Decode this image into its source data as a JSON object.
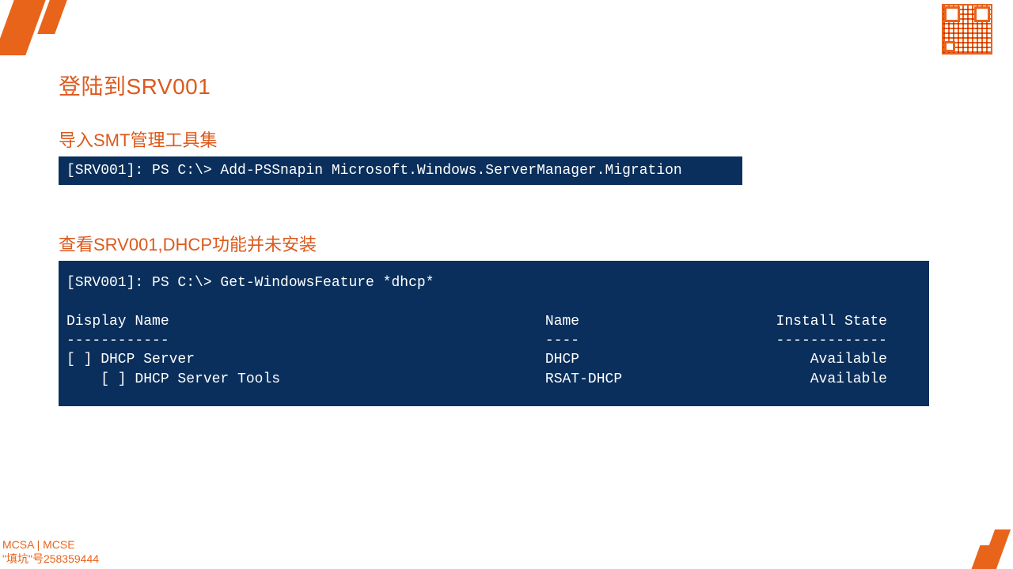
{
  "headings": {
    "main": "登陆到SRV001",
    "sub1": "导入SMT管理工具集",
    "sub2": "查看SRV001,DHCP功能并未安装"
  },
  "code": {
    "block1": "[SRV001]: PS C:\\> Add-PSSnapin Microsoft.Windows.ServerManager.Migration",
    "block2": "[SRV001]: PS C:\\> Get-WindowsFeature *dhcp*\n\nDisplay Name                                            Name                       Install State\n------------                                            ----                       -------------\n[ ] DHCP Server                                         DHCP                           Available\n    [ ] DHCP Server Tools                               RSAT-DHCP                      Available"
  },
  "footer": {
    "line1": "MCSA | MCSE",
    "line2": "\"填坑\"号258359444"
  }
}
